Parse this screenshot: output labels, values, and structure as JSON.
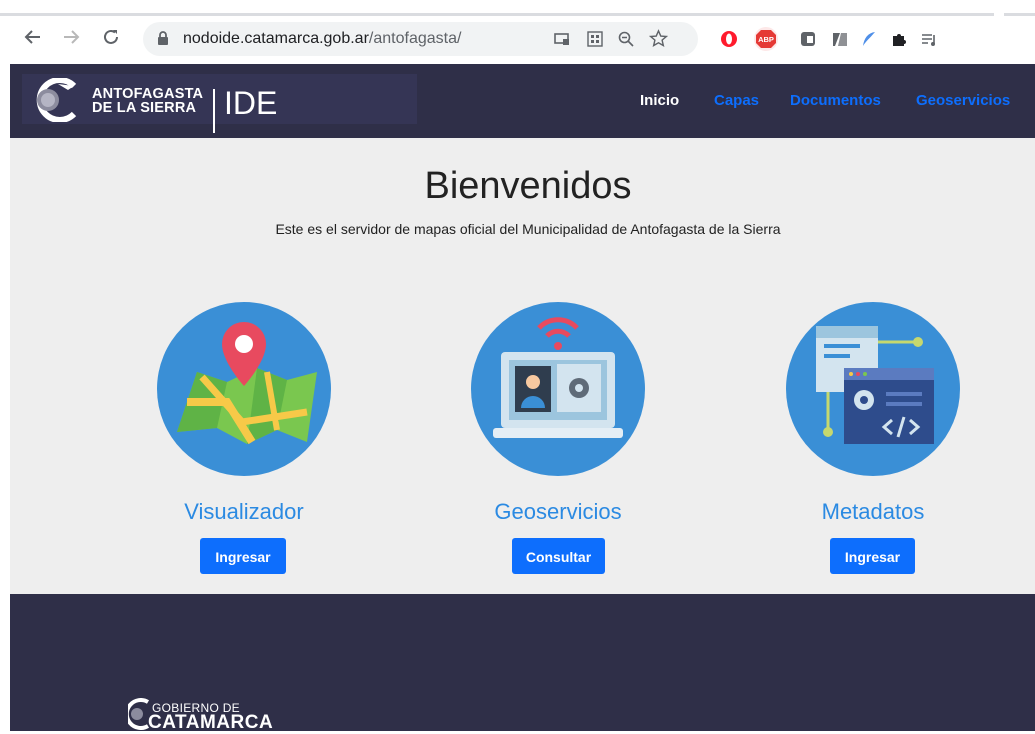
{
  "browser": {
    "url_host": "nodoide.catamarca.gob.ar",
    "url_path": "/antofagasta/",
    "extensions": [
      "cast-icon",
      "qr-icon",
      "zoom-icon",
      "star-icon",
      "opera-icon",
      "adblock-icon",
      "ext-icon",
      "ext2-icon",
      "feather-icon",
      "puzzle-icon",
      "reading-list-icon"
    ],
    "abp_label": "ABP"
  },
  "header": {
    "brand_line1": "ANTOFAGASTA",
    "brand_line2": "DE LA SIERRA",
    "brand_ide": "IDE",
    "menu": [
      {
        "label": "Inicio",
        "active": true
      },
      {
        "label": "Capas",
        "active": false
      },
      {
        "label": "Documentos",
        "active": false
      },
      {
        "label": "Geoservicios",
        "active": false
      }
    ]
  },
  "main": {
    "title": "Bienvenidos",
    "subtitle": "Este es el servidor de mapas oficial del Municipalidad de Antofagasta de la Sierra",
    "cards": [
      {
        "title": "Visualizador",
        "button": "Ingresar",
        "icon": "map-pin-icon"
      },
      {
        "title": "Geoservicios",
        "button": "Consultar",
        "icon": "laptop-settings-icon"
      },
      {
        "title": "Metadatos",
        "button": "Ingresar",
        "icon": "code-window-icon"
      }
    ]
  },
  "footer": {
    "logo_small": "GOBIERNO DE",
    "logo_big": "CATAMARCA"
  },
  "colors": {
    "nav_bg": "#2f2f48",
    "accent": "#0d6efd",
    "card_title": "#2b8ae2",
    "circle": "#3a8fd6",
    "main_bg": "#eeeeee"
  }
}
